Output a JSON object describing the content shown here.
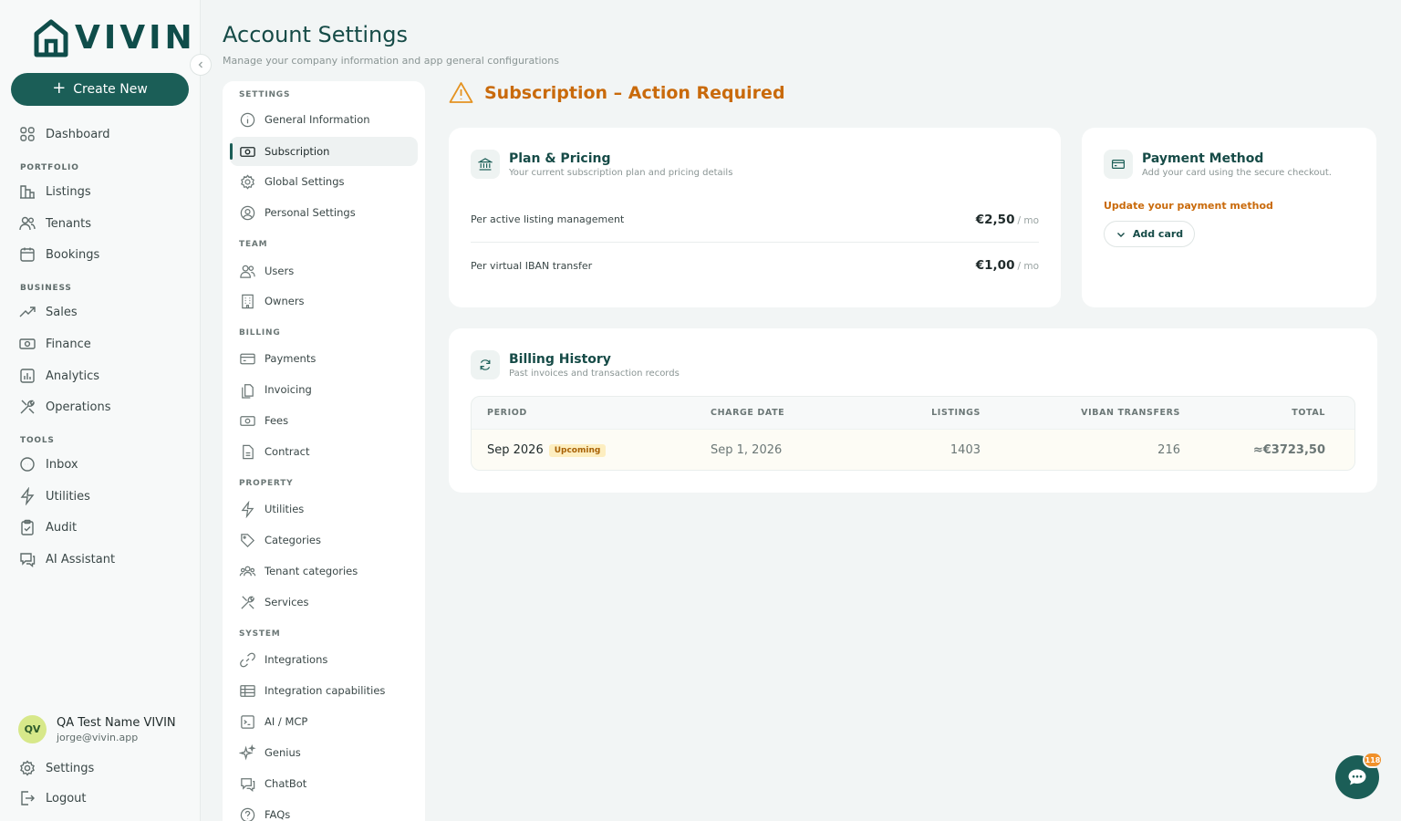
{
  "brand": {
    "name": "VIVIN",
    "accent": "#1b5e57",
    "warning": "#c96a0b"
  },
  "sidebar": {
    "create_label": "Create New",
    "dashboard": "Dashboard",
    "sections": {
      "portfolio": "PORTFOLIO",
      "business": "BUSINESS",
      "tools": "TOOLS"
    },
    "portfolio_items": [
      "Listings",
      "Tenants",
      "Bookings"
    ],
    "business_items": [
      "Sales",
      "Finance",
      "Analytics",
      "Operations"
    ],
    "tools_items": [
      "Inbox",
      "Utilities",
      "Audit",
      "AI Assistant"
    ],
    "user": {
      "initials": "QV",
      "name": "QA Test Name VIVIN",
      "email": "jorge@vivin.app"
    },
    "settings": "Settings",
    "logout": "Logout"
  },
  "header": {
    "title": "Account Settings",
    "subtitle": "Manage your company information and app general configurations"
  },
  "settings_menu": {
    "sections": {
      "settings": "SETTINGS",
      "team": "TEAM",
      "billing": "BILLING",
      "property": "PROPERTY",
      "system": "SYSTEM"
    },
    "settings_items": [
      "General Information",
      "Subscription",
      "Global Settings",
      "Personal Settings"
    ],
    "team_items": [
      "Users",
      "Owners"
    ],
    "billing_items": [
      "Payments",
      "Invoicing",
      "Fees",
      "Contract"
    ],
    "property_items": [
      "Utilities",
      "Categories",
      "Tenant categories",
      "Services"
    ],
    "system_items": [
      "Integrations",
      "Integration capabilities",
      "AI / MCP",
      "Genius",
      "ChatBot",
      "FAQs"
    ],
    "active": "Subscription"
  },
  "alert": {
    "title": "Subscription – Action Required"
  },
  "plan": {
    "title": "Plan & Pricing",
    "subtitle": "Your current subscription plan and pricing details",
    "rows": [
      {
        "label": "Per active listing management",
        "price": "€2,50",
        "period": "/ mo"
      },
      {
        "label": "Per virtual IBAN transfer",
        "price": "€1,00",
        "period": "/ mo"
      }
    ]
  },
  "payment": {
    "title": "Payment Method",
    "subtitle": "Add your card using the secure checkout.",
    "warning": "Update your payment method",
    "add_card": "Add card"
  },
  "billing_history": {
    "title": "Billing History",
    "subtitle": "Past invoices and transaction records",
    "columns": [
      "PERIOD",
      "CHARGE DATE",
      "LISTINGS",
      "VIBAN TRANSFERS",
      "TOTAL"
    ],
    "rows": [
      {
        "period": "Sep 2026",
        "badge": "Upcoming",
        "charge_date": "Sep 1, 2026",
        "listings": "1403",
        "viban": "216",
        "total": "≈€3723,50"
      }
    ]
  },
  "chat": {
    "badge": "118"
  }
}
